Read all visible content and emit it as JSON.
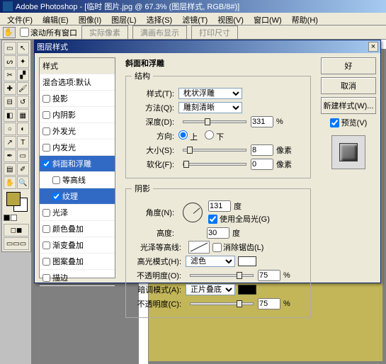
{
  "app": {
    "title": "Adobe Photoshop - [临时 图片.jpg @ 67.3% (图层样式, RGB/8#)]"
  },
  "menu": {
    "file": "文件(F)",
    "edit": "编辑(E)",
    "image": "图像(I)",
    "layer": "图层(L)",
    "select": "选择(S)",
    "filter": "滤镜(T)",
    "view": "视图(V)",
    "window": "窗口(W)",
    "help": "帮助(H)"
  },
  "options": {
    "scroll_all": "滚动所有窗口",
    "actual_px": "实际像素",
    "fit_screen": "满画布显示",
    "print_size": "打印尺寸"
  },
  "dialog": {
    "title": "图层样式",
    "styles_header": "样式",
    "blend_defaults": "混合选项:默认",
    "drop_shadow": "投影",
    "inner_shadow": "内阴影",
    "outer_glow": "外发光",
    "inner_glow": "内发光",
    "bevel_emboss": "斜面和浮雕",
    "contour": "等高线",
    "texture": "纹理",
    "satin": "光泽",
    "color_overlay": "颜色叠加",
    "grad_overlay": "渐变叠加",
    "pat_overlay": "图案叠加",
    "stroke": "描边"
  },
  "structure": {
    "group": "斜面和浮雕",
    "sub": "结构",
    "style_lbl": "样式(T):",
    "style_val": "枕状浮雕",
    "tech_lbl": "方法(Q):",
    "tech_val": "雕刻清晰",
    "depth_lbl": "深度(D):",
    "depth_val": "331",
    "pct": "%",
    "dir_lbl": "方向:",
    "dir_up": "上",
    "dir_down": "下",
    "size_lbl": "大小(S):",
    "size_val": "8",
    "px": "像素",
    "soften_lbl": "软化(F):",
    "soften_val": "0"
  },
  "shading": {
    "group": "阴影",
    "angle_lbl": "角度(N):",
    "angle_val": "131",
    "deg": "度",
    "global": "使用全局光(G)",
    "alt_lbl": "高度:",
    "alt_val": "30",
    "gloss_lbl": "光泽等高线:",
    "antialias": "消除锯齿(L)",
    "hi_mode_lbl": "高光模式(H):",
    "hi_mode_val": "滤色",
    "opacity_lbl": "不透明度(O):",
    "hi_op_val": "75",
    "sh_mode_lbl": "暗调模式(A):",
    "sh_mode_val": "正片叠底",
    "sh_op_lbl": "不透明度(C):",
    "sh_op_val": "75"
  },
  "buttons": {
    "ok": "好",
    "cancel": "取消",
    "new_style": "新建样式(W)...",
    "preview": "预览(V)"
  }
}
